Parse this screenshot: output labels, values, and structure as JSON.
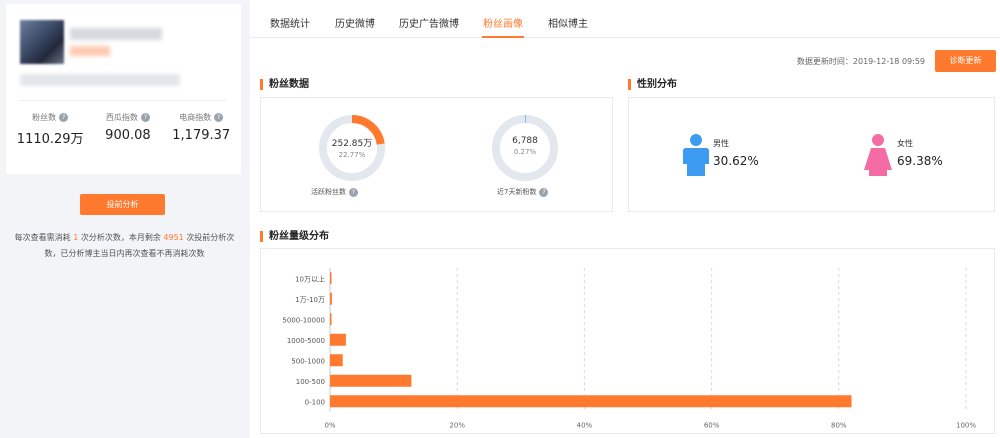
{
  "left": {
    "stats": [
      {
        "label": "粉丝数",
        "value": "1110.29万"
      },
      {
        "label": "西瓜指数",
        "value": "900.08"
      },
      {
        "label": "电商指数",
        "value": "1,179.37"
      }
    ],
    "analyze_button": "投前分析",
    "notice": {
      "part1": "每次查看需消耗",
      "cost": "1",
      "part2": "次分析次数，本月剩余",
      "remaining": "4951",
      "part3": "次投前分析次数，已分析博主当日内再次查看不再消耗次数"
    }
  },
  "tabs": [
    "数据统计",
    "历史微博",
    "历史广告微博",
    "粉丝画像",
    "相似博主"
  ],
  "active_tab": "粉丝画像",
  "update_time": "数据更新时间：2019-12-18 09:59",
  "diagnose_button": "诊断更新",
  "fans_data": {
    "title": "粉丝数据",
    "active": {
      "value": "252.85万",
      "percent": "22.77%",
      "ratio": 0.2277,
      "label": "活跃粉丝数"
    },
    "new7": {
      "value": "6,788",
      "percent": "0.27%",
      "ratio": 0.0027,
      "label": "近7天新粉数"
    }
  },
  "gender": {
    "title": "性别分布",
    "male_label": "男性",
    "male_value": "30.62%",
    "female_label": "女性",
    "female_value": "69.38%",
    "male_color": "#3d9bf2",
    "female_color": "#f56ca4"
  },
  "chart_data": {
    "type": "bar",
    "title": "粉丝量级分布",
    "orientation": "horizontal",
    "categories": [
      "10万以上",
      "1万-10万",
      "5000-10000",
      "1000-5000",
      "500-1000",
      "100-500",
      "0-100"
    ],
    "values": [
      0.2,
      0.3,
      0.2,
      2.5,
      2.0,
      12.8,
      82.0
    ],
    "xticks": [
      "0%",
      "20%",
      "40%",
      "60%",
      "80%",
      "100%"
    ],
    "xlim": [
      0,
      100
    ],
    "grid": true,
    "color": "#ff7a2e"
  }
}
